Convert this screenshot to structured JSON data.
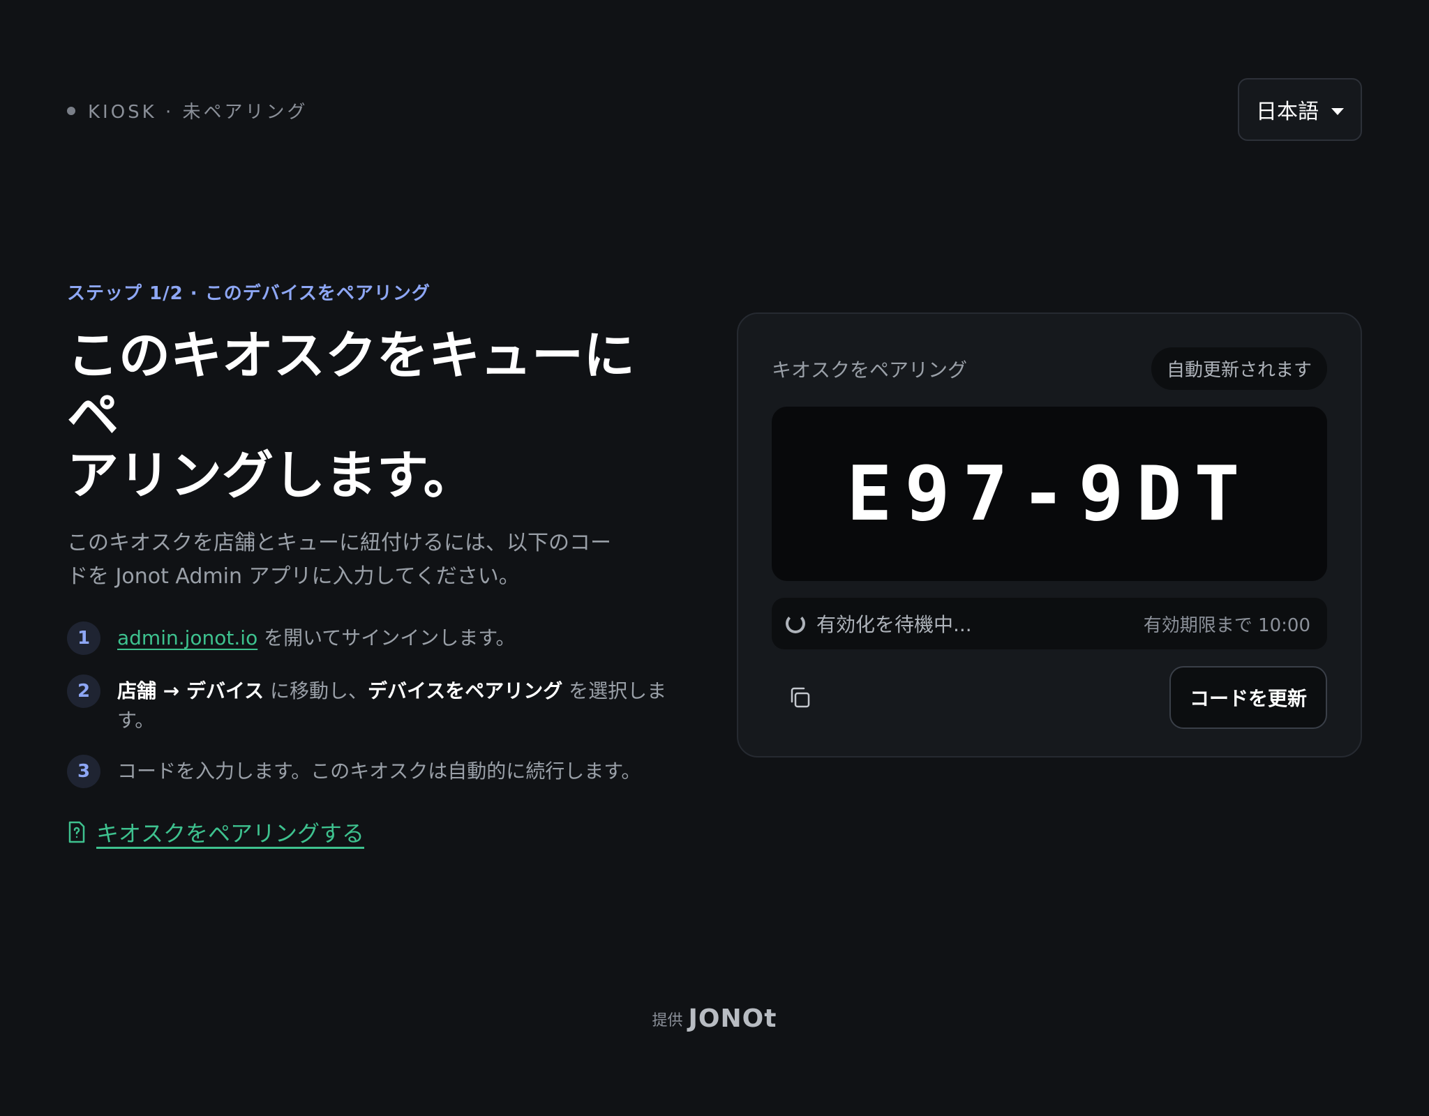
{
  "header": {
    "status": "KIOSK · 未ペアリング",
    "language": "日本語"
  },
  "main": {
    "step_label": "ステップ 1/2 · このデバイスをペアリング",
    "headline_line1": "このキオスクをキューにペ",
    "headline_line2": "アリングします。",
    "intro": "このキオスクを店舗とキューに紐付けるには、以下のコードを Jonot Admin アプリに入力してください。",
    "steps": [
      {
        "number": "1",
        "link": "admin.jonot.io",
        "text": " を開いてサインインします。"
      },
      {
        "number": "2",
        "bold1": "店舗 → デバイス",
        "text1": " に移動し、",
        "bold2": "デバイスをペアリング",
        "text2": " を選択します。"
      },
      {
        "number": "3",
        "text": "コードを入力します。このキオスクは自動的に続行します。"
      }
    ],
    "help_link": "キオスクをペアリングする"
  },
  "card": {
    "title": "キオスクをペアリング",
    "auto_badge": "自動更新されます",
    "code": "E97-9DT",
    "waiting": "有効化を待機中...",
    "expiry": "有効期限まで 10:00",
    "refresh_label": "コードを更新"
  },
  "footer": {
    "provided_by": "提供",
    "logo": "JONOt"
  },
  "colors": {
    "background": "#101215",
    "accent_blue": "#8ea7f5",
    "accent_green": "#3ec28f",
    "card": "#16191d"
  },
  "icons": {
    "status": "status-dot-icon",
    "language": "caret-down-icon",
    "help": "help-document-icon",
    "spinner": "loading-spinner-icon",
    "copy": "copy-icon"
  }
}
